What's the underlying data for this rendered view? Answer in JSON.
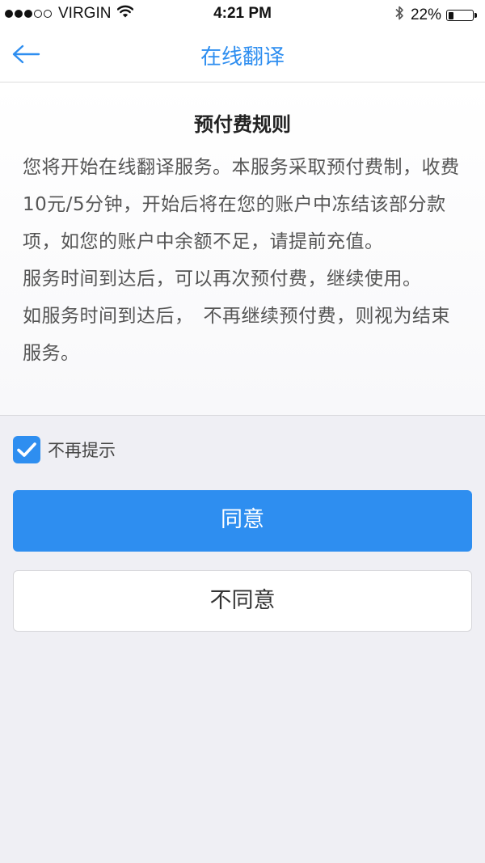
{
  "status_bar": {
    "carrier": "VIRGIN",
    "time": "4:21 PM",
    "battery_percent_text": "22%",
    "battery_level": 0.22,
    "signal_bars_filled": 3,
    "signal_bars_total": 5,
    "icons": [
      "wifi-icon",
      "bluetooth-icon",
      "battery-icon"
    ]
  },
  "nav": {
    "title": "在线翻译",
    "back_icon": "arrow-left-icon"
  },
  "rules": {
    "title": "预付费规则",
    "paragraphs": [
      "您将开始在线翻译服务。本服务采取预付费制，收费10元/5分钟，开始后将在您的账户中冻结该部分款项，如您的账户中余额不足，请提前充值。",
      "服务时间到达后，可以再次预付费，继续使用。",
      "如服务时间到达后，　不再继续预付费，则视为结束服务。"
    ]
  },
  "no_remind": {
    "label": "不再提示",
    "checked": true
  },
  "buttons": {
    "agree": "同意",
    "disagree": "不同意"
  },
  "colors": {
    "accent": "#2e8ef0",
    "background": "#efeff4"
  }
}
